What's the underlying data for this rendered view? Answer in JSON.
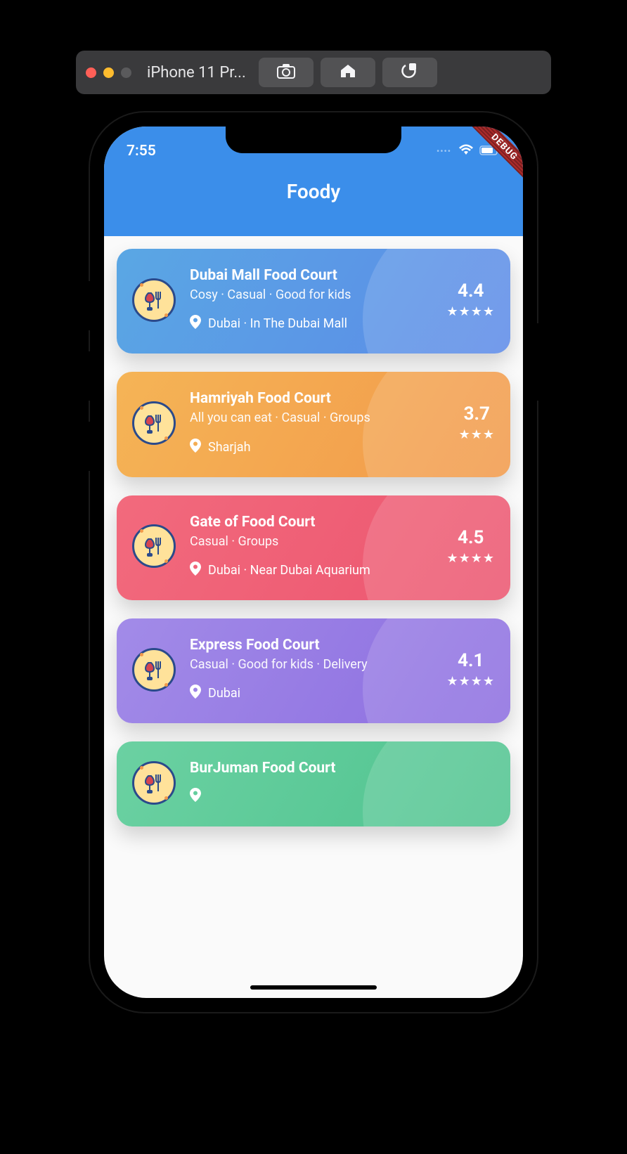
{
  "macToolbar": {
    "title": "iPhone 11 Pr..."
  },
  "statusBar": {
    "time": "7:55"
  },
  "debugBanner": "DEBUG",
  "appTitle": "Foody",
  "cards": [
    {
      "color": "blue",
      "title": "Dubai Mall Food Court",
      "tags": "Cosy · Casual · Good for kids",
      "location": "Dubai · In The Dubai Mall",
      "rating": "4.4",
      "stars": 4
    },
    {
      "color": "orange",
      "title": "Hamriyah Food Court",
      "tags": "All you can eat · Casual · Groups",
      "location": "Sharjah",
      "rating": "3.7",
      "stars": 3
    },
    {
      "color": "pink",
      "title": "Gate of Food Court",
      "tags": "Casual · Groups",
      "location": "Dubai · Near Dubai Aquarium",
      "rating": "4.5",
      "stars": 4
    },
    {
      "color": "purple",
      "title": "Express Food Court",
      "tags": "Casual · Good for kids · Delivery",
      "location": "Dubai",
      "rating": "4.1",
      "stars": 4
    },
    {
      "color": "green",
      "title": "BurJuman Food Court",
      "tags": "",
      "location": "",
      "rating": "",
      "stars": 0
    }
  ]
}
